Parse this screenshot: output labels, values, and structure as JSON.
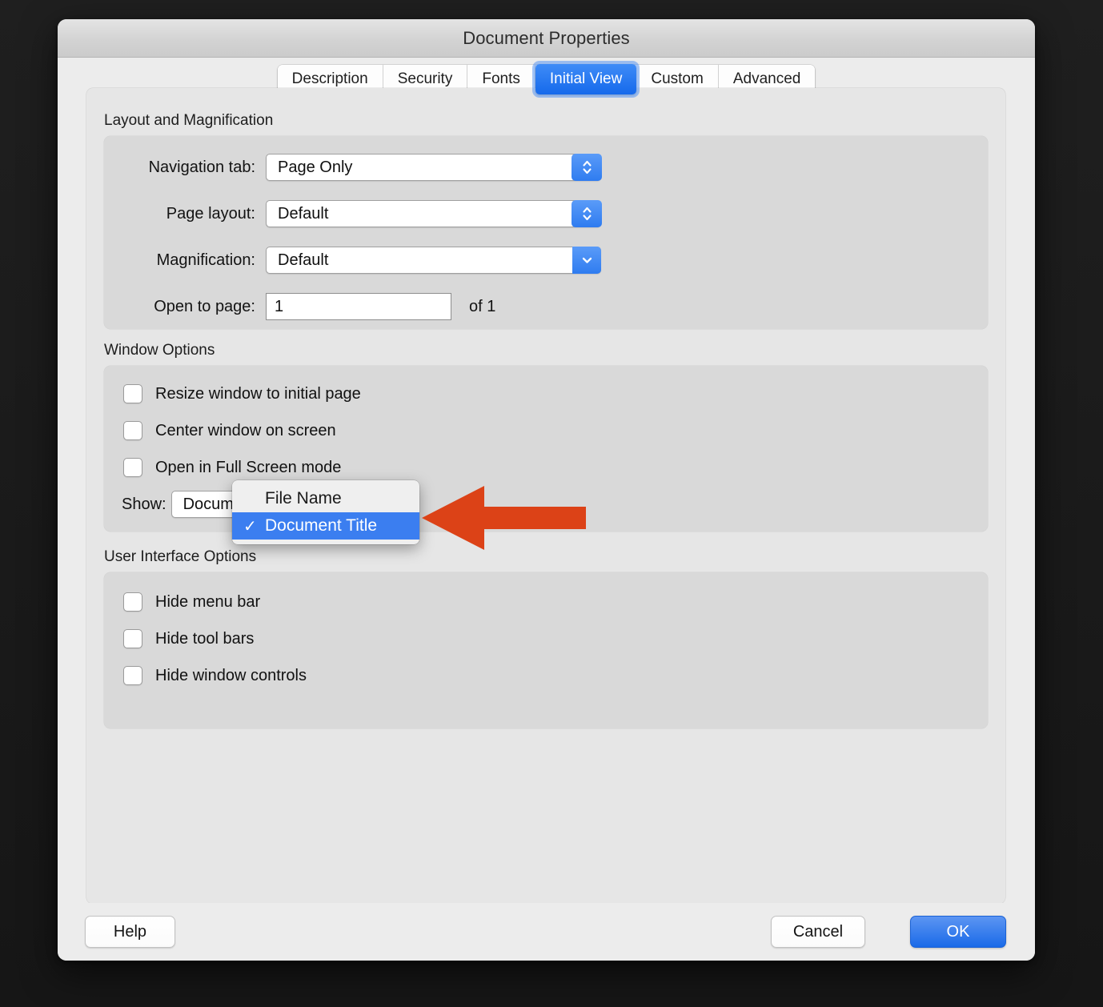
{
  "window": {
    "title": "Document Properties"
  },
  "tabs": [
    {
      "label": "Description",
      "selected": false
    },
    {
      "label": "Security",
      "selected": false
    },
    {
      "label": "Fonts",
      "selected": false
    },
    {
      "label": "Initial View",
      "selected": true
    },
    {
      "label": "Custom",
      "selected": false
    },
    {
      "label": "Advanced",
      "selected": false
    }
  ],
  "layout_section": {
    "title": "Layout and Magnification",
    "rows": [
      {
        "label": "Navigation tab:",
        "value": "Page Only",
        "control": "stepper-popup"
      },
      {
        "label": "Page layout:",
        "value": "Default",
        "control": "stepper-popup"
      },
      {
        "label": "Magnification:",
        "value": "Default",
        "control": "chevron-popup"
      }
    ],
    "open_to_page": {
      "label": "Open to page:",
      "value": "1",
      "suffix": "of 1"
    }
  },
  "window_options": {
    "title": "Window Options",
    "checkboxes": [
      {
        "label": "Resize window to initial page",
        "checked": false
      },
      {
        "label": "Center window on screen",
        "checked": false
      },
      {
        "label": "Open in Full Screen mode",
        "checked": false
      }
    ],
    "show": {
      "label": "Show:",
      "value": "Document Title"
    }
  },
  "ui_options": {
    "title": "User Interface Options",
    "checkboxes": [
      {
        "label": "Hide menu bar",
        "checked": false
      },
      {
        "label": "Hide tool bars",
        "checked": false
      },
      {
        "label": "Hide window controls",
        "checked": false
      }
    ]
  },
  "open_menu": {
    "items": [
      {
        "label": "File Name",
        "selected": false,
        "check": ""
      },
      {
        "label": "Document Title",
        "selected": true,
        "check": "✓"
      }
    ]
  },
  "footer": {
    "help_label": "Help",
    "cancel_label": "Cancel",
    "ok_label": "OK"
  },
  "annotation": {
    "arrow_color": "#DC4217",
    "points_to": "Show: popup menu"
  },
  "colors": {
    "accent_blue": "#1E6AE8",
    "selection_blue": "#3B7EF0",
    "window_bg": "#ECECEC",
    "panel_bg": "#E6E6E6",
    "group_bg": "#D9D9D9",
    "desktop_bg": "#1C1C1C"
  }
}
